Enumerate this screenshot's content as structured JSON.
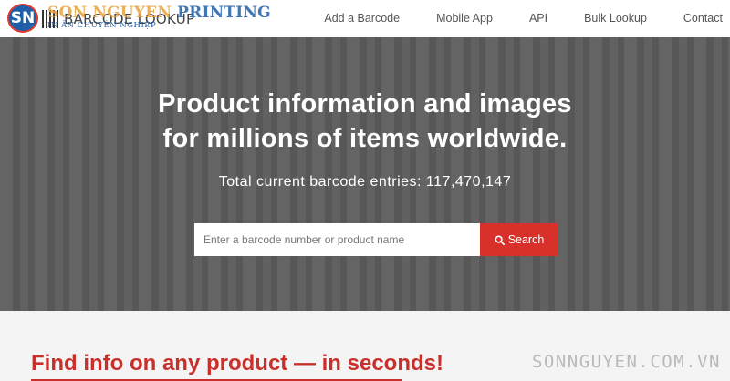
{
  "header": {
    "logo": {
      "badge": "SN",
      "brand_text": "BARCODE LOOKUP",
      "watermark_line1_a": "SON NGUYEN",
      "watermark_line1_b": " PRINTING",
      "watermark_line2": "IN ẤN CHUYÊN NGHIỆP"
    },
    "nav": [
      {
        "label": "Add a Barcode"
      },
      {
        "label": "Mobile App"
      },
      {
        "label": "API"
      },
      {
        "label": "Bulk Lookup"
      },
      {
        "label": "Contact"
      }
    ]
  },
  "hero": {
    "title_line1": "Product information and images",
    "title_line2": "for millions of items worldwide.",
    "count_text": "Total current barcode entries: 117,470,147",
    "search": {
      "placeholder": "Enter a barcode number or product name",
      "value": "",
      "button_label": "Search",
      "button_icon": "search-icon"
    }
  },
  "lower": {
    "title": "Find info on any product — in seconds!"
  },
  "watermark": "SONNGUYEN.COM.VN",
  "colors": {
    "accent_red": "#d8302a",
    "hero_bg": "#5c5c5c",
    "brand_blue": "#1f5fa8"
  }
}
